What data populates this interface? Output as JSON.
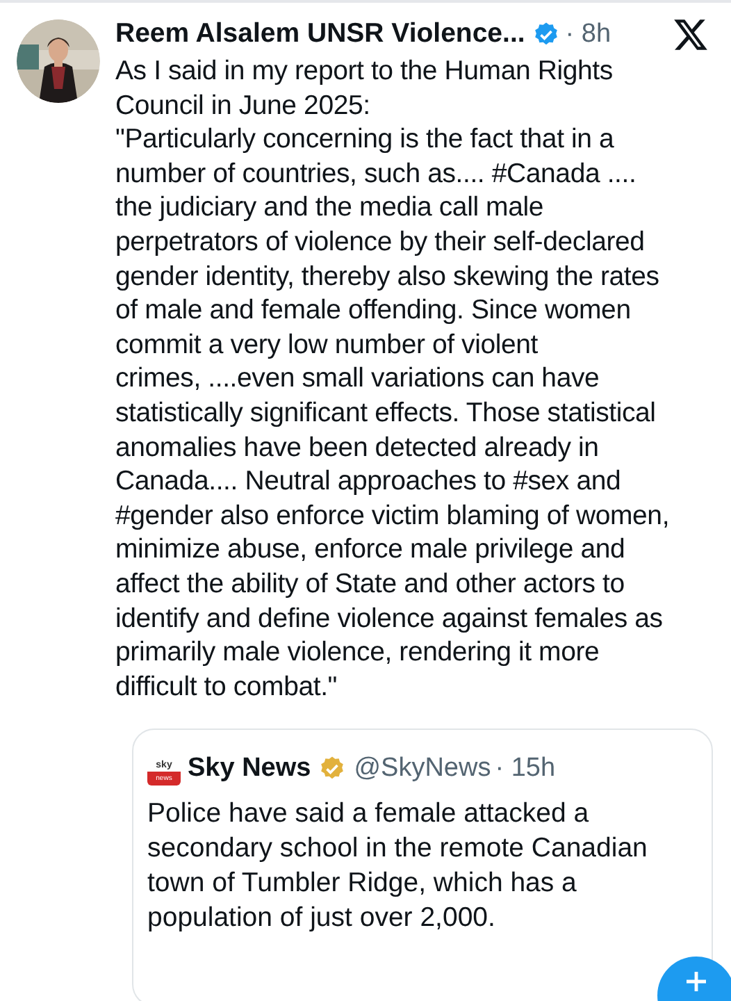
{
  "post": {
    "author": "Reem Alsalem UNSR Violence...",
    "verified": true,
    "time": "· 8h",
    "paragraphs": [
      [
        "As I said in my report to the Human Rights",
        "Council in June 2025:"
      ],
      [
        "\"Particularly concerning is the fact that in a",
        "number of countries, such as.... #Canada ....",
        "the judiciary and the media call male",
        "perpetrators of violence by their self-declared",
        "gender identity, thereby also skewing the rates",
        "of male and female offending. Since women",
        "commit a very low number of violent",
        "crimes, ....even small variations can have",
        "statistically significant effects. Those statistical",
        "anomalies have been detected already in",
        "Canada.... Neutral approaches to #sex and",
        "#gender also enforce victim blaming of women,",
        "minimize abuse, enforce male privilege and",
        "affect the ability of State and other actors to",
        "identify and define violence against females as",
        "primarily male violence, rendering it more",
        "difficult to combat.\""
      ]
    ],
    "quote": {
      "logo_top": "sky",
      "logo_bottom": "news",
      "author": "Sky News",
      "verified": true,
      "handle": "@SkyNews",
      "time": "· 15h",
      "lines": [
        "Police have said a female attacked a",
        "secondary school in the remote Canadian",
        "town of Tumbler Ridge, which has a",
        "population of just over 2,000."
      ]
    }
  }
}
